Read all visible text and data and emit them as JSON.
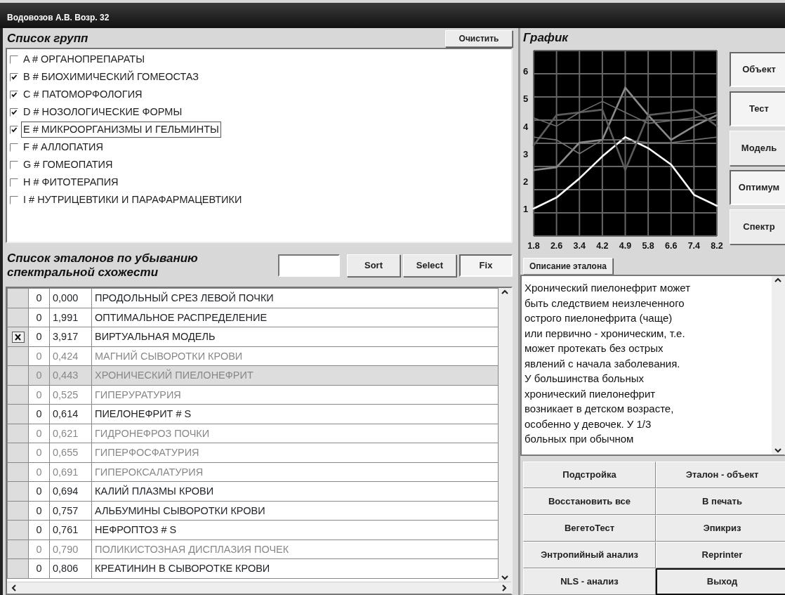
{
  "window": {
    "title": "Водовозов А.В. Возр. 32"
  },
  "groups": {
    "title": "Список групп",
    "clear_button": "Очистить",
    "items": [
      {
        "label": "A # ОРГАНОПРЕПАРАТЫ",
        "checked": false,
        "focused": false
      },
      {
        "label": "B # БИОХИМИЧЕСКИЙ ГОМЕОСТАЗ",
        "checked": true,
        "focused": false
      },
      {
        "label": "C # ПАТОМОРФОЛОГИЯ",
        "checked": true,
        "focused": false
      },
      {
        "label": "D # НОЗОЛОГИЧЕСКИЕ ФОРМЫ",
        "checked": true,
        "focused": false
      },
      {
        "label": "E # МИКРООРГАНИЗМЫ И ГЕЛЬМИНТЫ",
        "checked": true,
        "focused": true
      },
      {
        "label": "F # АЛЛОПАТИЯ",
        "checked": false,
        "focused": false
      },
      {
        "label": "G # ГОМЕОПАТИЯ",
        "checked": false,
        "focused": false
      },
      {
        "label": "H # ФИТОТЕРАПИЯ",
        "checked": false,
        "focused": false
      },
      {
        "label": "I # НУТРИЦЕВТИКИ И ПАРАФАРМАЦЕВТИКИ",
        "checked": false,
        "focused": false
      }
    ]
  },
  "chart": {
    "title": "График",
    "chart_data": {
      "type": "line",
      "grid": true,
      "categories": [
        "1.8",
        "2.6",
        "3.4",
        "4.2",
        "4.9",
        "5.8",
        "6.6",
        "7.4",
        "8.2"
      ],
      "ylim": [
        0,
        6.75
      ],
      "yticks": [
        1,
        2,
        3,
        4,
        5,
        6
      ],
      "series": [
        {
          "color": "#ffffff",
          "values": [
            1.0,
            1.4,
            2.1,
            2.9,
            3.6,
            3.2,
            2.6,
            1.5,
            1.1
          ]
        },
        {
          "color": "#8a8a8a",
          "values": [
            2.4,
            2.5,
            3.4,
            3.5,
            5.4,
            4.4,
            3.5,
            4.0,
            4.4
          ]
        },
        {
          "color": "#5c5c5c",
          "values": [
            3.3,
            4.4,
            4.5,
            4.6,
            2.4,
            4.4,
            4.5,
            4.6,
            4.0
          ]
        },
        {
          "color": "#6e6e6e",
          "values": [
            4.3,
            4.0,
            4.5,
            4.9,
            4.5,
            4.1,
            4.2,
            4.3,
            4.5
          ]
        },
        {
          "color": "#747474",
          "values": [
            3.6,
            3.5,
            3.0,
            3.5,
            3.5,
            3.4,
            3.4,
            3.5,
            3.6
          ]
        }
      ]
    },
    "buttons": [
      {
        "label": "Объект",
        "pressed": true
      },
      {
        "label": "Тест",
        "pressed": true
      },
      {
        "label": "Модель",
        "pressed": false
      },
      {
        "label": "Оптимум",
        "pressed": true
      },
      {
        "label": "Спектр",
        "pressed": false
      }
    ]
  },
  "standards": {
    "title": "Список эталонов по убыванию спектральной схожести",
    "buttons": [
      {
        "label": "Sort",
        "pressed": false
      },
      {
        "label": "Select",
        "pressed": false
      },
      {
        "label": "Fix",
        "pressed": true
      }
    ],
    "rows": [
      {
        "marked": false,
        "count": "0",
        "score": "0,000",
        "name": "ПРОДОЛЬНЫЙ СРЕЗ ЛЕВОЙ ПОЧКИ",
        "dimmed": false,
        "selected": false
      },
      {
        "marked": false,
        "count": "0",
        "score": "1,991",
        "name": "ОПТИМАЛЬНОЕ РАСПРЕДЕЛЕНИЕ",
        "dimmed": false,
        "selected": false
      },
      {
        "marked": true,
        "count": "0",
        "score": "3,917",
        "name": "ВИРТУАЛЬНАЯ МОДЕЛЬ",
        "dimmed": false,
        "selected": false
      },
      {
        "marked": false,
        "count": "0",
        "score": "0,424",
        "name": "МАГНИЙ СЫВОРОТКИ КРОВИ",
        "dimmed": true,
        "selected": false
      },
      {
        "marked": false,
        "count": "0",
        "score": "0,443",
        "name": "ХРОНИЧЕСКИЙ ПИЕЛОНЕФРИТ",
        "dimmed": true,
        "selected": true
      },
      {
        "marked": false,
        "count": "0",
        "score": "0,525",
        "name": "ГИПЕРУРАТУРИЯ",
        "dimmed": true,
        "selected": false
      },
      {
        "marked": false,
        "count": "0",
        "score": "0,614",
        "name": "ПИЕЛОНЕФРИТ # S",
        "dimmed": false,
        "selected": false
      },
      {
        "marked": false,
        "count": "0",
        "score": "0,621",
        "name": "ГИДРОНЕФРОЗ ПОЧКИ",
        "dimmed": true,
        "selected": false
      },
      {
        "marked": false,
        "count": "0",
        "score": "0,655",
        "name": "ГИПЕРФОСФАТУРИЯ",
        "dimmed": true,
        "selected": false
      },
      {
        "marked": false,
        "count": "0",
        "score": "0,691",
        "name": "ГИПЕРОКСАЛАТУРИЯ",
        "dimmed": true,
        "selected": false
      },
      {
        "marked": false,
        "count": "0",
        "score": "0,694",
        "name": "КАЛИЙ ПЛАЗМЫ КРОВИ",
        "dimmed": false,
        "selected": false
      },
      {
        "marked": false,
        "count": "0",
        "score": "0,757",
        "name": "АЛЬБУМИНЫ СЫВОРОТКИ КРОВИ",
        "dimmed": false,
        "selected": false
      },
      {
        "marked": false,
        "count": "0",
        "score": "0,761",
        "name": "НЕФРОПТОЗ # S",
        "dimmed": false,
        "selected": false
      },
      {
        "marked": false,
        "count": "0",
        "score": "0,790",
        "name": "ПОЛИКИСТОЗНАЯ ДИСПЛАЗИЯ ПОЧЕК",
        "dimmed": true,
        "selected": false
      },
      {
        "marked": false,
        "count": "0",
        "score": "0,806",
        "name": "КРЕАТИНИН В СЫВОРОТКЕ КРОВИ",
        "dimmed": false,
        "selected": false
      }
    ]
  },
  "description": {
    "tab": "Описание эталона",
    "text": "Хронический пиелонефрит может\nбыть следствием неизлеченного\nострого пиелонефрита (чаще)\nили первично - хроническим, т.е.\nможет протекать без острых\nявлений с начала заболевания.\nУ большинства больных\nхронический пиелонефрит\nвозникает в детском возрасте,\nособенно у девочек. У 1/3\nбольных при обычном"
  },
  "actions": [
    {
      "label": "Подстройка",
      "default": false
    },
    {
      "label": "Эталон - объект",
      "default": false
    },
    {
      "label": "Восстановить все",
      "default": false
    },
    {
      "label": "В печать",
      "default": false
    },
    {
      "label": "ВегетоТест",
      "default": false
    },
    {
      "label": "Эпикриз",
      "default": false
    },
    {
      "label": "Энтропийный анализ",
      "default": false
    },
    {
      "label": "Reprinter",
      "default": false
    },
    {
      "label": "NLS - анализ",
      "default": false
    },
    {
      "label": "Выход",
      "default": true
    }
  ]
}
